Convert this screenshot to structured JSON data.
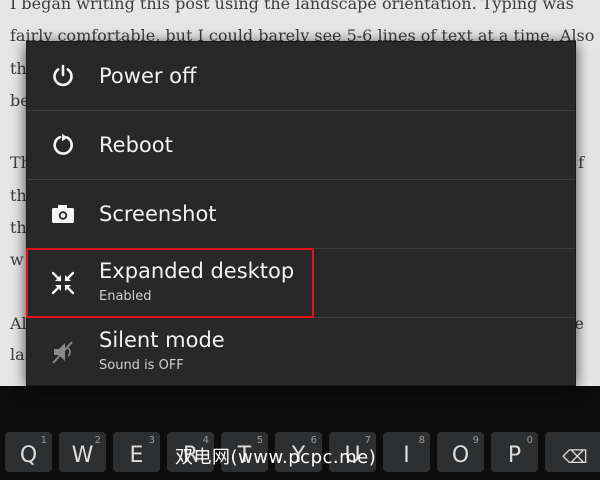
{
  "article": {
    "lines": [
      "I began writing this post using the landscape orientation. Typing was",
      "fairly comfortable, but I could barely see 5-6 lines of text at a time. Also",
      "th",
      "be",
      "Th",
      "f",
      "th",
      "th",
      "w",
      "Al",
      "e",
      "la"
    ]
  },
  "power_menu": {
    "items": [
      {
        "label": "Power off",
        "icon": "power-icon"
      },
      {
        "label": "Reboot",
        "icon": "reboot-icon"
      },
      {
        "label": "Screenshot",
        "icon": "camera-icon"
      },
      {
        "label": "Expanded desktop",
        "status": "Enabled",
        "icon": "collapse-arrows-icon",
        "highlighted": true
      },
      {
        "label": "Silent mode",
        "status": "Sound is OFF",
        "icon": "muted-speaker-icon"
      }
    ],
    "highlight_color": "#e0121b"
  },
  "keyboard": {
    "keys": [
      {
        "letter": "Q",
        "number": "1"
      },
      {
        "letter": "W",
        "number": "2"
      },
      {
        "letter": "E",
        "number": "3"
      },
      {
        "letter": "R",
        "number": "4"
      },
      {
        "letter": "T",
        "number": "5"
      },
      {
        "letter": "Y",
        "number": "6"
      },
      {
        "letter": "U",
        "number": "7"
      },
      {
        "letter": "I",
        "number": "8"
      },
      {
        "letter": "O",
        "number": "9"
      },
      {
        "letter": "P",
        "number": "0"
      }
    ],
    "backspace": "⌫"
  },
  "watermark": "双电网(www.pcpc.me)"
}
